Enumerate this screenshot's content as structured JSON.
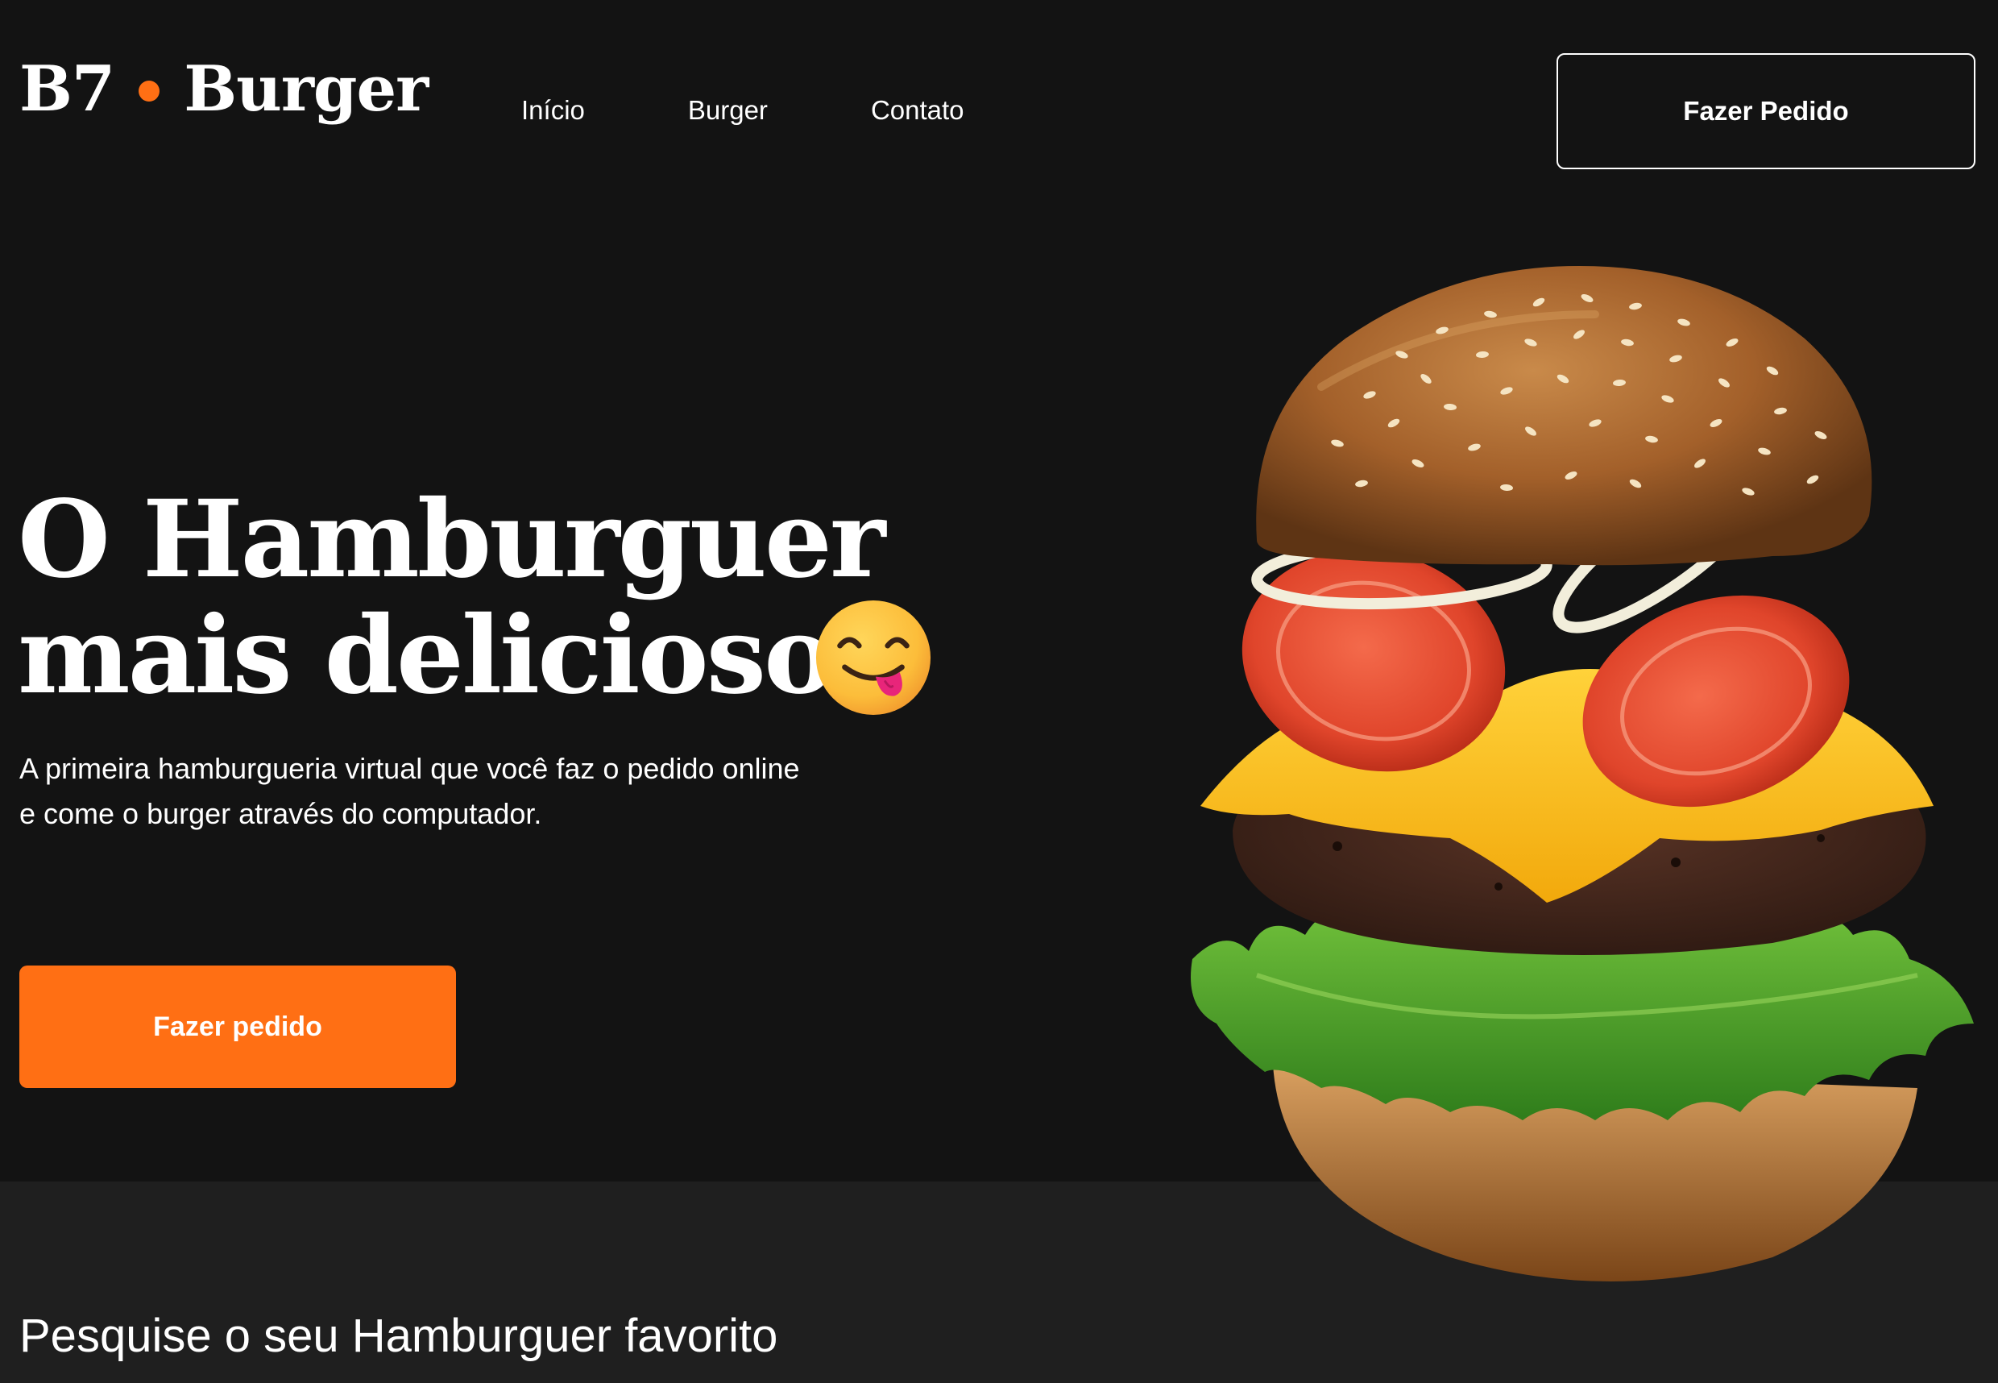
{
  "brand": {
    "left": "B7",
    "right": "Burger",
    "dot_color": "#ff6f14"
  },
  "nav": {
    "items": [
      "Início",
      "Burger",
      "Contato"
    ]
  },
  "header": {
    "cta_label": "Fazer Pedido"
  },
  "hero": {
    "title_line1": "O Hamburguer",
    "title_line2": "mais delicioso.",
    "emoji": "face-savoring-food-icon",
    "subtitle": "A primeira hamburgueria virtual que você faz o pedido online e come o burger através do computador.",
    "cta_label": "Fazer pedido",
    "image": "burger-illustration"
  },
  "search_section": {
    "title": "Pesquise o seu Hamburguer favorito"
  },
  "colors": {
    "background": "#131313",
    "section_background": "#1f1f1f",
    "accent": "#ff6f14",
    "text": "#ffffff"
  }
}
